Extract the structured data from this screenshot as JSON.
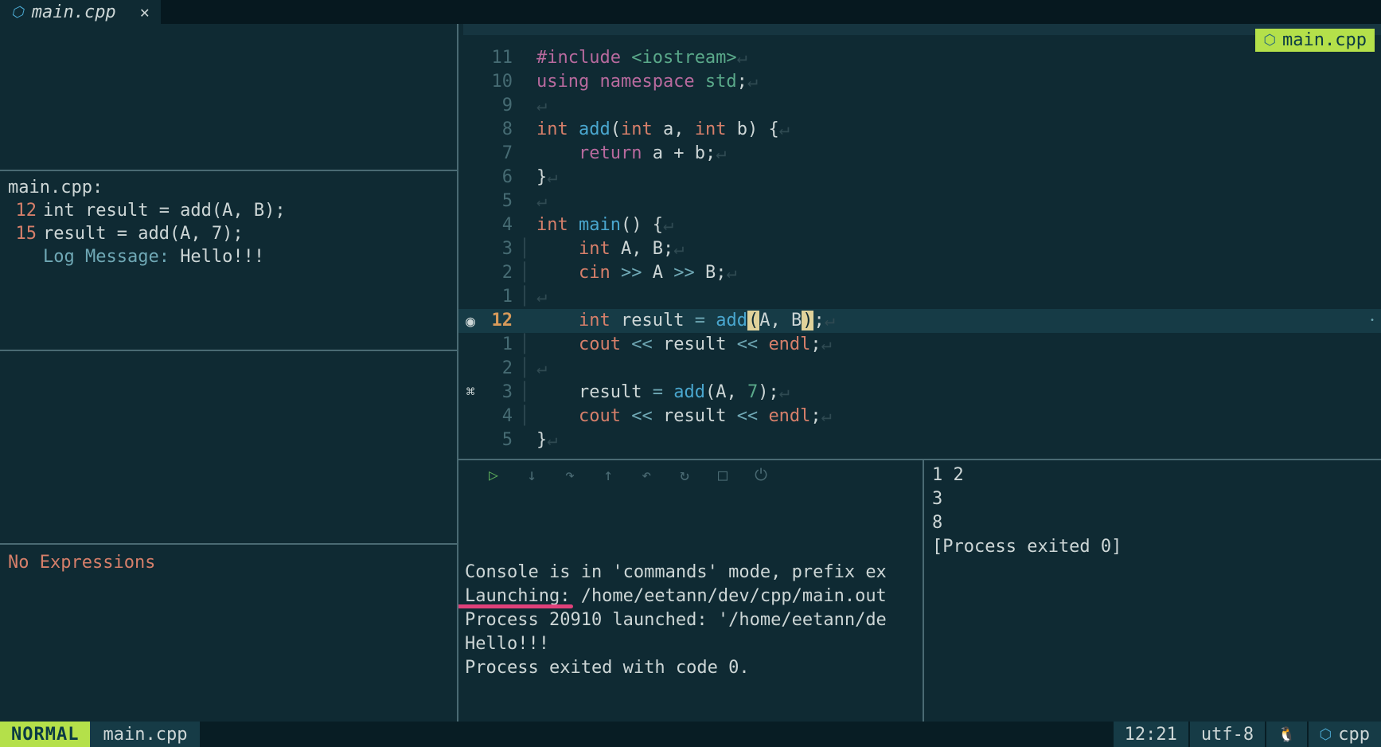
{
  "tab": {
    "label": "main.cpp",
    "icon": "cpp"
  },
  "badge": {
    "label": "main.cpp"
  },
  "breakpoints": {
    "file": "main.cpp:",
    "items": [
      {
        "line": "12",
        "text": "int result = add(A, B);"
      },
      {
        "line": "15",
        "text": "result = add(A, 7);"
      }
    ],
    "log": {
      "key": "Log Message: ",
      "val": "Hello!!!"
    }
  },
  "expressions": {
    "empty": "No Expressions"
  },
  "code": {
    "lines": [
      {
        "sign": "",
        "num": "11",
        "tokens": [
          [
            "kw-pre",
            "#include "
          ],
          [
            "str",
            "<iostream>"
          ],
          [
            "ws",
            "↵"
          ]
        ]
      },
      {
        "sign": "",
        "num": "10",
        "tokens": [
          [
            "kw-pre",
            "using namespace "
          ],
          [
            "str",
            "std"
          ],
          [
            "",
            ";"
          ],
          [
            "ws",
            "↵"
          ]
        ]
      },
      {
        "sign": "",
        "num": "9",
        "tokens": [
          [
            "ws",
            "↵"
          ]
        ]
      },
      {
        "sign": "",
        "num": "8",
        "tokens": [
          [
            "kw-type",
            "int "
          ],
          [
            "fn",
            "add"
          ],
          [
            "",
            "("
          ],
          [
            "kw-type",
            "int"
          ],
          [
            "",
            " a, "
          ],
          [
            "kw-type",
            "int"
          ],
          [
            "",
            " b) {"
          ],
          [
            "ws",
            "↵"
          ]
        ]
      },
      {
        "sign": "",
        "num": "7",
        "tokens": [
          [
            "",
            "    "
          ],
          [
            "kw-pre",
            "return"
          ],
          [
            "",
            " a + b;"
          ],
          [
            "ws",
            "↵"
          ]
        ]
      },
      {
        "sign": "",
        "num": "6",
        "tokens": [
          [
            "",
            "}"
          ],
          [
            "ws",
            "↵"
          ]
        ]
      },
      {
        "sign": "",
        "num": "5",
        "tokens": [
          [
            "ws",
            "↵"
          ]
        ]
      },
      {
        "sign": "",
        "num": "4",
        "tokens": [
          [
            "kw-type",
            "int "
          ],
          [
            "fn",
            "main"
          ],
          [
            "",
            "() {"
          ],
          [
            "ws",
            "↵"
          ]
        ]
      },
      {
        "sign": "",
        "num": "3",
        "fold": "│",
        "tokens": [
          [
            "",
            "    "
          ],
          [
            "kw-type",
            "int"
          ],
          [
            "",
            " A, B;"
          ],
          [
            "ws",
            "↵"
          ]
        ]
      },
      {
        "sign": "",
        "num": "2",
        "fold": "│",
        "tokens": [
          [
            "",
            "    "
          ],
          [
            "kw-type",
            "cin"
          ],
          [
            "",
            " "
          ],
          [
            "op",
            ">>"
          ],
          [
            "",
            " A "
          ],
          [
            "op",
            ">>"
          ],
          [
            "",
            " B;"
          ],
          [
            "ws",
            "↵"
          ]
        ]
      },
      {
        "sign": "",
        "num": "1",
        "fold": "│",
        "tokens": [
          [
            "ws",
            "↵"
          ]
        ]
      },
      {
        "sign": "bp",
        "num": "12",
        "current": true,
        "fold": "",
        "tokens": [
          [
            "",
            "    "
          ],
          [
            "kw-type",
            "int"
          ],
          [
            "",
            " result "
          ],
          [
            "op",
            "="
          ],
          [
            "",
            " "
          ],
          [
            "fn",
            "add"
          ],
          [
            "cursor-paren",
            "("
          ],
          [
            "",
            "A, B"
          ],
          [
            "cursor-paren",
            ")"
          ],
          [
            "",
            ";"
          ],
          [
            "ws",
            "↵"
          ]
        ],
        "dot": true
      },
      {
        "sign": "",
        "num": "1",
        "fold": "│",
        "tokens": [
          [
            "",
            "    "
          ],
          [
            "kw-type",
            "cout"
          ],
          [
            "",
            " "
          ],
          [
            "op",
            "<<"
          ],
          [
            "",
            " result "
          ],
          [
            "op",
            "<<"
          ],
          [
            "",
            " "
          ],
          [
            "kw-type",
            "endl"
          ],
          [
            "",
            ";"
          ],
          [
            "ws",
            "↵"
          ]
        ]
      },
      {
        "sign": "",
        "num": "2",
        "fold": "│",
        "tokens": [
          [
            "ws",
            "↵"
          ]
        ]
      },
      {
        "sign": "log",
        "num": "3",
        "fold": "│",
        "tokens": [
          [
            "",
            "    result "
          ],
          [
            "op",
            "="
          ],
          [
            "",
            " "
          ],
          [
            "fn",
            "add"
          ],
          [
            "",
            "(A, "
          ],
          [
            "str",
            "7"
          ],
          [
            "",
            ");"
          ],
          [
            "ws",
            "↵"
          ]
        ]
      },
      {
        "sign": "",
        "num": "4",
        "fold": "│",
        "tokens": [
          [
            "",
            "    "
          ],
          [
            "kw-type",
            "cout"
          ],
          [
            "",
            " "
          ],
          [
            "op",
            "<<"
          ],
          [
            "",
            " result "
          ],
          [
            "op",
            "<<"
          ],
          [
            "",
            " "
          ],
          [
            "kw-type",
            "endl"
          ],
          [
            "",
            ";"
          ],
          [
            "ws",
            "↵"
          ]
        ]
      },
      {
        "sign": "",
        "num": "5",
        "tokens": [
          [
            "",
            "}"
          ],
          [
            "ws",
            "↵"
          ]
        ]
      }
    ]
  },
  "console": {
    "lines": [
      "Console is in 'commands' mode, prefix ex",
      "Launching: /home/eetann/dev/cpp/main.out",
      "Process 20910 launched: '/home/eetann/de",
      "Hello!!!",
      "Process exited with code 0."
    ]
  },
  "output": {
    "lines": [
      "1 2",
      "3",
      "8",
      "",
      "[Process exited 0]"
    ]
  },
  "status": {
    "mode": "NORMAL",
    "file": "main.cpp",
    "pos": "12:21",
    "enc": "utf-8",
    "ft": "cpp"
  }
}
